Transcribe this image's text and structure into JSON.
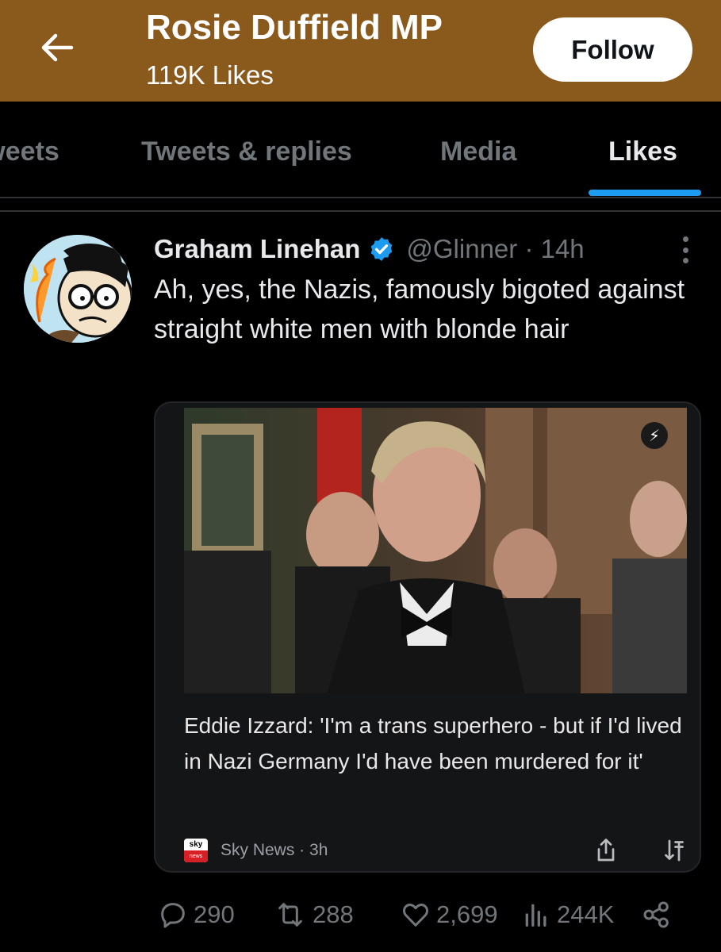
{
  "header": {
    "title": "Rosie Duffield MP",
    "subtitle": "119K Likes",
    "follow_label": "Follow",
    "back_icon": "arrow-left-icon",
    "background": "#8a5a1c"
  },
  "tabs": [
    {
      "label": "Tweets",
      "active": false
    },
    {
      "label": "Tweets & replies",
      "active": false
    },
    {
      "label": "Media",
      "active": false
    },
    {
      "label": "Likes",
      "active": true
    }
  ],
  "tweet": {
    "author_name": "Graham Linehan",
    "verified": true,
    "handle": "@Glinner",
    "time": "14h",
    "handle_line": "@Glinner · 14h",
    "text": "Ah, yes, the Nazis, famously bigoted against straight white men with blonde hair",
    "card": {
      "headline": "Eddie Izzard: 'I'm a trans superhero - but if I'd lived in Nazi Germany I'd have been murdered for it'",
      "source": "Sky News",
      "age": "3h",
      "source_line": "Sky News · 3h",
      "logo_top": "sky",
      "logo_bottom": "news",
      "amp_icon": "lightning-icon"
    },
    "stats": {
      "replies": "290",
      "retweets": "288",
      "likes": "2,699",
      "views": "244K"
    }
  },
  "colors": {
    "accent": "#1d9bf0",
    "muted": "#71767b",
    "text": "#e7e9ea"
  }
}
